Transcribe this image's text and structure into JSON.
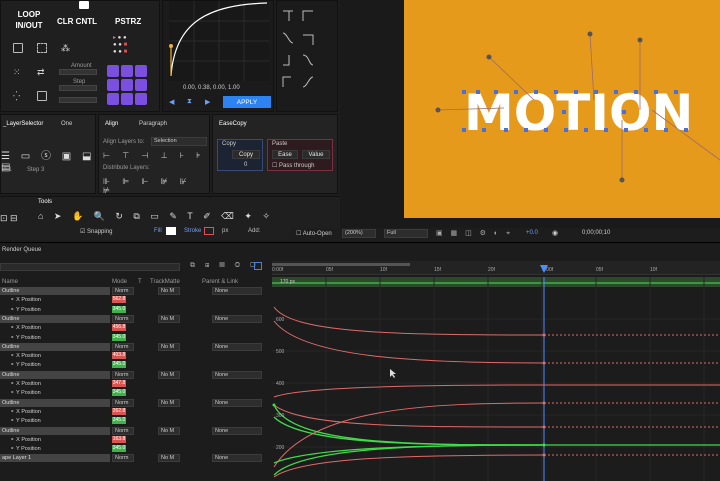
{
  "motion_panel": {
    "loop_label": "LOOP\nIN/OUT",
    "clr_cntl_label": "CLR CNTL",
    "pstrz_label": "PSTRZ",
    "small_labels": [
      "Amount",
      "Step",
      "",
      "Kpt"
    ],
    "curve_readout": "0.00, 0.38, 0.00, 1.00",
    "apply_label": "APPLY"
  },
  "panels": {
    "layer_selector_tab": "_LayerSelector",
    "one_tab": "One",
    "align_tab": "Align",
    "paragraph_tab": "Paragraph",
    "align_layers_to": "Align Layers to:",
    "align_selection": "Selection",
    "distribute_layers": "Distribute Layers:",
    "easecopy_tab": "EaseCopy",
    "copy_title": "Copy",
    "copy_btn": "Copy",
    "copy_value": "0",
    "paste_title": "Paste",
    "ease_btn": "Ease",
    "value_btn": "Value",
    "pass_through": "Pass through",
    "layer_sel_labels": [
      "A 1",
      "Step",
      "3"
    ],
    "tools_tab": "Tools",
    "snapping": "Snapping",
    "fill_label": "Fill",
    "stroke_label": "Stroke",
    "px_label": "px",
    "add_label": "Add:"
  },
  "viewer": {
    "text": "MOTION",
    "bg_color": "#e69a1c",
    "auto_open": "Auto-Open",
    "zoom": "(200%)",
    "resolution": "Full",
    "exposure": "+0.0",
    "timecode": "0;00;00;10"
  },
  "timeline": {
    "render_queue": "Render Queue",
    "col_name": "Name",
    "col_mode": "Mode",
    "col_t": "T",
    "col_trkmat": "TrackMatte",
    "col_parent": "Parent & Link",
    "rows": [
      {
        "name": "Outline",
        "type": "layer",
        "mode": "Norm",
        "trk": "No M",
        "parent": "None"
      },
      {
        "name": "X Position",
        "type": "sub",
        "val": "562.8",
        "color": "red"
      },
      {
        "name": "Y Position",
        "type": "sub",
        "val": "345.0",
        "color": "green"
      },
      {
        "name": "Outline",
        "type": "layer",
        "mode": "Norm",
        "trk": "No M",
        "parent": "None"
      },
      {
        "name": "X Position",
        "type": "sub",
        "val": "456.8",
        "color": "red"
      },
      {
        "name": "Y Position",
        "type": "sub",
        "val": "345.0",
        "color": "green"
      },
      {
        "name": "Outline",
        "type": "layer",
        "mode": "Norm",
        "trk": "No M",
        "parent": "None"
      },
      {
        "name": "X Position",
        "type": "sub",
        "val": "403.8",
        "color": "red"
      },
      {
        "name": "Y Position",
        "type": "sub",
        "val": "345.0",
        "color": "green"
      },
      {
        "name": "Outline",
        "type": "layer",
        "mode": "Norm",
        "trk": "No M",
        "parent": "None"
      },
      {
        "name": "X Position",
        "type": "sub",
        "val": "347.8",
        "color": "red"
      },
      {
        "name": "Y Position",
        "type": "sub",
        "val": "345.0",
        "color": "green"
      },
      {
        "name": "Outline",
        "type": "layer",
        "mode": "Norm",
        "trk": "No M",
        "parent": "None"
      },
      {
        "name": "X Position",
        "type": "sub",
        "val": "262.8",
        "color": "red"
      },
      {
        "name": "Y Position",
        "type": "sub",
        "val": "345.0",
        "color": "green"
      },
      {
        "name": "Outline",
        "type": "layer",
        "mode": "Norm",
        "trk": "No M",
        "parent": "None"
      },
      {
        "name": "X Position",
        "type": "sub",
        "val": "163.8",
        "color": "red"
      },
      {
        "name": "Y Position",
        "type": "sub",
        "val": "345.0",
        "color": "green"
      },
      {
        "name": "ape Layer 1",
        "type": "layer",
        "mode": "Norm",
        "trk": "No M",
        "parent": "None"
      }
    ],
    "ruler_labels": [
      "0:00f",
      "05f",
      "10f",
      "15f",
      "20f",
      "1:00f",
      "05f",
      "10f"
    ],
    "graph_labels": [
      "600",
      "500",
      "400",
      "300",
      "200"
    ],
    "graph_top_label": "170 px"
  }
}
